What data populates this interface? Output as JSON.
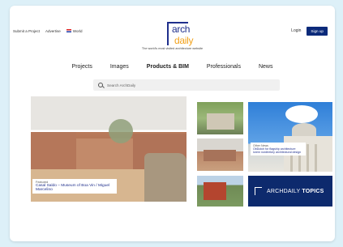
{
  "header": {
    "left_links": [
      "Submit a Project",
      "Advertise"
    ],
    "region_label": "World",
    "login_label": "Login",
    "signup_label": "Sign up",
    "logo_line1": "arch",
    "logo_line2": "daily",
    "tagline": "The world's most visited architecture website"
  },
  "nav": {
    "items": [
      {
        "label": "Projects",
        "strong": false
      },
      {
        "label": "Images",
        "strong": false
      },
      {
        "label": "Products & BIM",
        "strong": true
      },
      {
        "label": "Professionals",
        "strong": false
      },
      {
        "label": "News",
        "strong": false
      }
    ]
  },
  "search": {
    "placeholder": "Search ArchDaily"
  },
  "featured": {
    "label": "Featured",
    "title": "Casal Saldo – Museum of Boa Vin / Miguel Marcelino"
  },
  "secondary_feature": {
    "label": "Other News",
    "title": "ObDutch for flagship architecture lorem nordtrekey architectural design"
  },
  "topics_banner": {
    "brand": "ARCHDAILY",
    "word": "TOPICS"
  },
  "colors": {
    "brand_blue": "#1f2f8c",
    "brand_orange": "#f2a21b",
    "signup_bg": "#0b2a7a",
    "topics_bg": "#0d2a6d"
  }
}
